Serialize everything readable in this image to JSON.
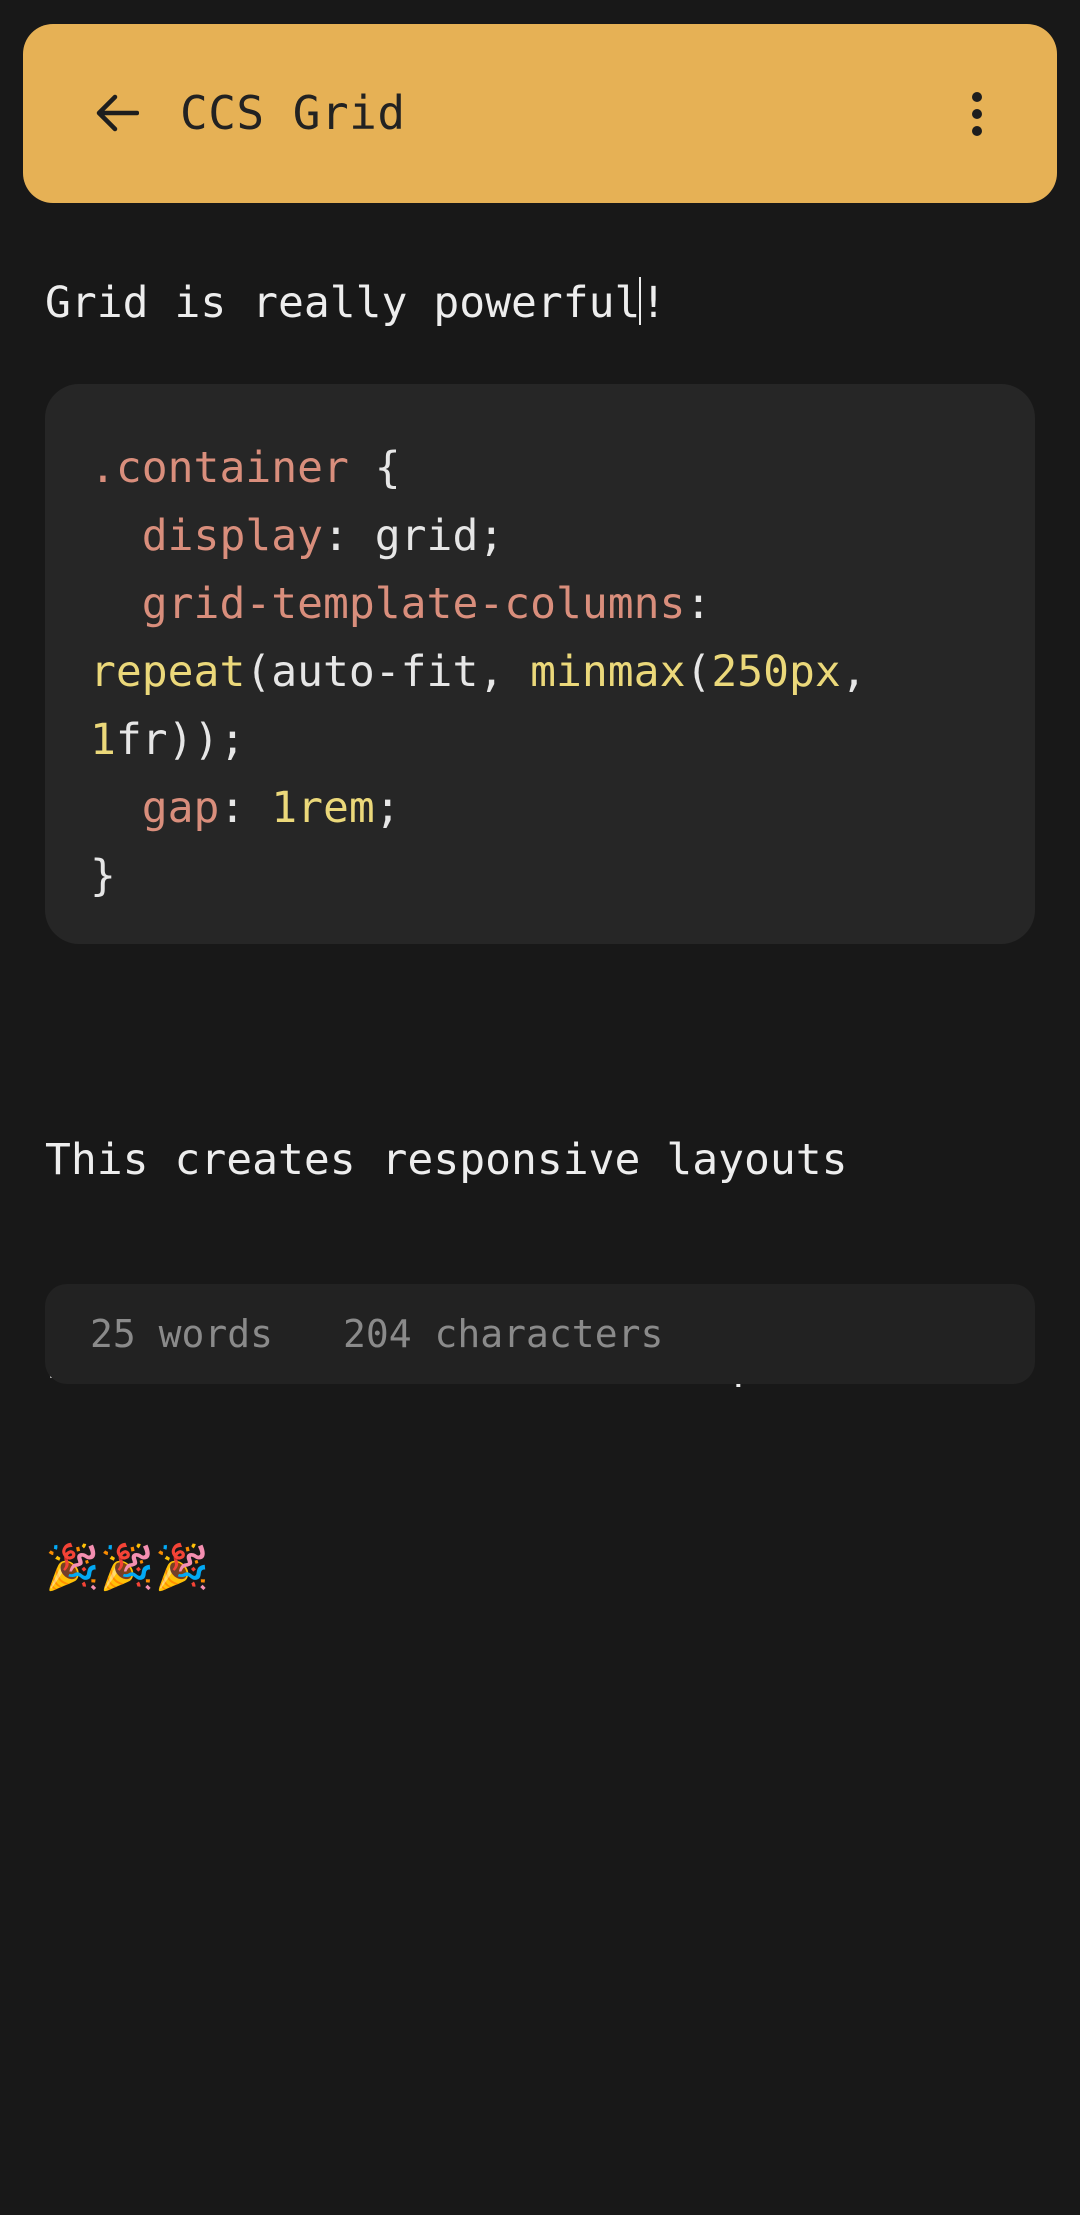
{
  "header": {
    "title": "CCS Grid",
    "back_icon": "arrow-left-icon",
    "menu_icon": "more-vertical-icon",
    "background_color": "#e6b155"
  },
  "note": {
    "first_line_before_caret": "Grid is really powerful",
    "first_line_after_caret": "!",
    "code": {
      "lines": [
        [
          {
            "t": ".container",
            "c": "sel"
          },
          {
            "t": " {",
            "c": "plain"
          }
        ],
        [
          {
            "t": "  ",
            "c": "plain"
          },
          {
            "t": "display",
            "c": "prop"
          },
          {
            "t": ": grid;",
            "c": "plain"
          }
        ],
        [
          {
            "t": "  ",
            "c": "plain"
          },
          {
            "t": "grid-template-columns",
            "c": "prop"
          },
          {
            "t": ":",
            "c": "plain"
          }
        ],
        [
          {
            "t": "repeat",
            "c": "fn"
          },
          {
            "t": "(auto-fit, ",
            "c": "plain"
          },
          {
            "t": "minmax",
            "c": "fn"
          },
          {
            "t": "(",
            "c": "plain"
          },
          {
            "t": "250px",
            "c": "num"
          },
          {
            "t": ",",
            "c": "plain"
          }
        ],
        [
          {
            "t": "1",
            "c": "num"
          },
          {
            "t": "fr));",
            "c": "plain"
          }
        ],
        [
          {
            "t": "  ",
            "c": "plain"
          },
          {
            "t": "gap",
            "c": "prop"
          },
          {
            "t": ": ",
            "c": "plain"
          },
          {
            "t": "1rem",
            "c": "num"
          },
          {
            "t": ";",
            "c": "plain"
          }
        ],
        [
          {
            "t": "}",
            "c": "plain"
          }
        ]
      ]
    },
    "paragraph_line1": "This creates responsive layouts",
    "paragraph_line2": "without the need of media queries.",
    "emojis": "🎉🎉🎉"
  },
  "stats": {
    "words": "25 words",
    "characters": "204 characters"
  }
}
